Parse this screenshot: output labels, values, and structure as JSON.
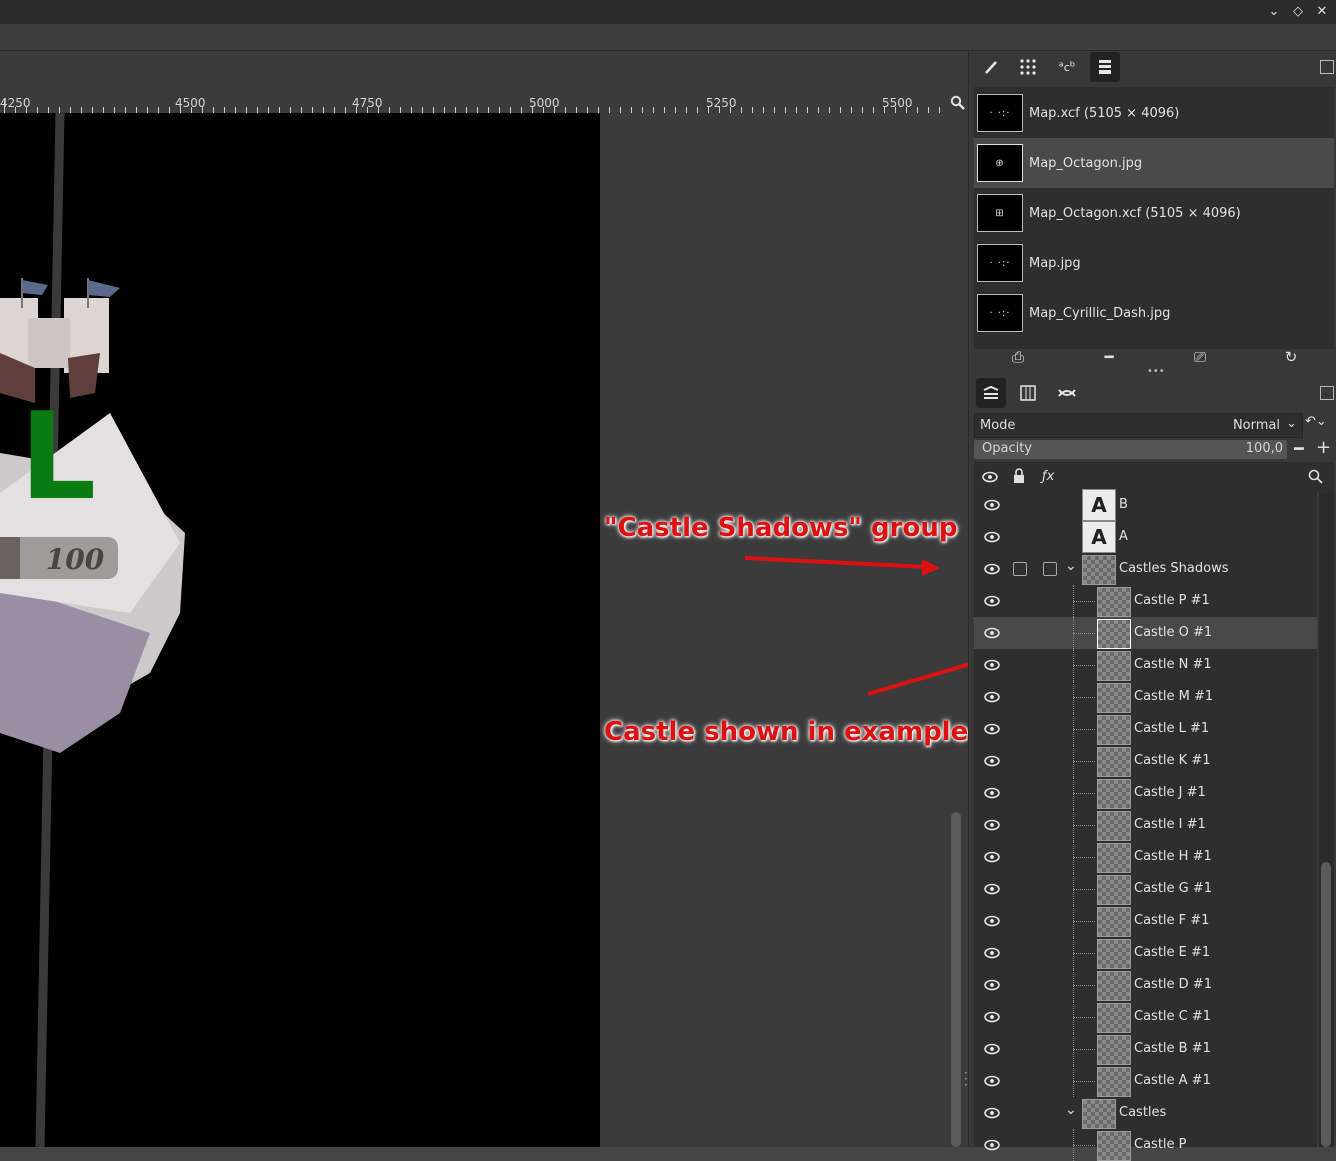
{
  "window": {
    "controls": [
      "⌄",
      "◇",
      "✕"
    ]
  },
  "ruler": {
    "labels": [
      "4250",
      "4500",
      "4750",
      "5000",
      "5250",
      "5500"
    ]
  },
  "canvas": {
    "badge_value": "100",
    "castle_letter": "L",
    "castle_letter_color": "#0a7a12"
  },
  "annotations": {
    "group_label": "\"Castle Shadows\" group",
    "castle_label": "Castle shown in example",
    "color": "#dd1111"
  },
  "images_panel": {
    "tabs": [
      "brush-icon",
      "patterns-icon",
      "fonts-icon",
      "images-icon"
    ],
    "items": [
      {
        "name": "Map.xcf (5105 × 4096)"
      },
      {
        "name": "Map_Octagon.jpg",
        "selected": true
      },
      {
        "name": "Map_Octagon.xcf (5105 × 4096)"
      },
      {
        "name": "Map.jpg"
      },
      {
        "name": "Map_Cyrillic_Dash.jpg"
      }
    ]
  },
  "layers_panel": {
    "tabs": [
      "layers-icon",
      "channels-icon",
      "paths-icon"
    ],
    "mode_label": "Mode",
    "mode_value": "Normal",
    "opacity_label": "Opacity",
    "opacity_value": "100,0",
    "rows": [
      {
        "name": "B",
        "kind": "text"
      },
      {
        "name": "A",
        "kind": "text"
      },
      {
        "name": "Castles Shadows",
        "kind": "group"
      },
      {
        "name": "Castle P #1",
        "kind": "layer"
      },
      {
        "name": "Castle O #1",
        "kind": "layer",
        "selected": true
      },
      {
        "name": "Castle N #1",
        "kind": "layer"
      },
      {
        "name": "Castle M #1",
        "kind": "layer"
      },
      {
        "name": "Castle L #1",
        "kind": "layer"
      },
      {
        "name": "Castle K #1",
        "kind": "layer"
      },
      {
        "name": "Castle J #1",
        "kind": "layer"
      },
      {
        "name": "Castle I #1",
        "kind": "layer"
      },
      {
        "name": "Castle H #1",
        "kind": "layer"
      },
      {
        "name": "Castle G #1",
        "kind": "layer"
      },
      {
        "name": "Castle F #1",
        "kind": "layer"
      },
      {
        "name": "Castle E #1",
        "kind": "layer"
      },
      {
        "name": "Castle D #1",
        "kind": "layer"
      },
      {
        "name": "Castle C #1",
        "kind": "layer"
      },
      {
        "name": "Castle B #1",
        "kind": "layer"
      },
      {
        "name": "Castle A #1",
        "kind": "layer"
      },
      {
        "name": "Castles",
        "kind": "group"
      },
      {
        "name": "Castle P",
        "kind": "layer"
      }
    ]
  }
}
